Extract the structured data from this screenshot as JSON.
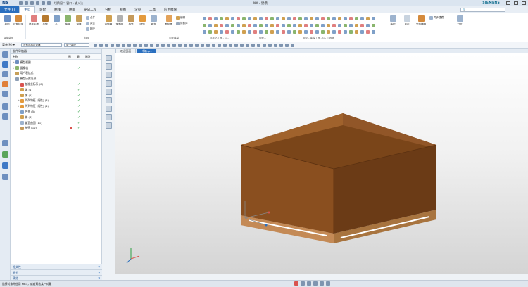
{
  "app": {
    "logo": "NX",
    "quick_access_text": "切换窗口 窗口 · 输入法",
    "window_title": "NX - 建模",
    "brand": "SIEMENS"
  },
  "tabs": [
    "文件(F)",
    "主页",
    "装配",
    "曲线",
    "曲面",
    "逆向工程",
    "分析",
    "视图",
    "渲染",
    "工具",
    "应用模块"
  ],
  "ribbon": {
    "buttons": [
      "草图",
      "拉伸特征",
      "基准平面",
      "拉伸",
      "孔",
      "抽取",
      "替换",
      "边倒圆",
      "倒斜角",
      "抽壳",
      "阵列",
      "更多",
      "移动面",
      "修剪体",
      "显示",
      "全部编辑"
    ],
    "small_items": [
      "合并",
      "减去",
      "相交",
      "编辑",
      "同步建模"
    ],
    "groups": [
      "直接草图",
      "特征",
      "同步建模",
      "标准化工具 - G...",
      "齿轮...",
      "齿轮 - 建模工具 - GC 工具箱",
      "装配",
      "分析"
    ]
  },
  "commandbar": {
    "menu": "菜单(M) ▾",
    "filter": "没有选择过滤器",
    "scope": "整个装配"
  },
  "navigator": {
    "title": "部件导航器",
    "columns": [
      "名称",
      "图",
      "最",
      "附注"
    ],
    "items": [
      {
        "label": "模型视图",
        "indent": 0,
        "exp": "+",
        "check": false
      },
      {
        "label": "摄像机",
        "indent": 0,
        "exp": "+",
        "check": true
      },
      {
        "label": "用户表达式",
        "indent": 0,
        "exp": "",
        "check": false
      },
      {
        "label": "模型历史记录",
        "indent": 0,
        "exp": "-",
        "check": false
      },
      {
        "label": "基准坐标系 (0)",
        "indent": 1,
        "exp": "",
        "check": true
      },
      {
        "label": "体 (1)",
        "indent": 1,
        "exp": "",
        "check": true
      },
      {
        "label": "体 (2)",
        "indent": 1,
        "exp": "",
        "check": true
      },
      {
        "label": "阵列特征 [线性] (3)",
        "indent": 1,
        "exp": "+",
        "check": true
      },
      {
        "label": "阵列特征 [线性] (4)",
        "indent": 1,
        "exp": "+",
        "check": true
      },
      {
        "label": "合并 (5)",
        "indent": 1,
        "exp": "",
        "check": true
      },
      {
        "label": "体 (6)",
        "indent": 1,
        "exp": "",
        "check": true
      },
      {
        "label": "偏置曲面 (11)",
        "indent": 1,
        "exp": "",
        "check": true
      },
      {
        "label": "抽壳 (12)",
        "indent": 1,
        "exp": "",
        "check": true
      }
    ],
    "footer": [
      "相关性",
      "细节",
      "预览"
    ]
  },
  "document_tabs": [
    "欢迎页面",
    "木箱.prt"
  ],
  "status": {
    "text": "选择对象并使用 MB3，或者双击某一对象"
  },
  "colors": {
    "accent": "#2a6fbf",
    "box_front": "#8a4f1f",
    "box_side": "#6b3b16",
    "box_top": "#a0622c",
    "pallet": "#c48a56"
  }
}
